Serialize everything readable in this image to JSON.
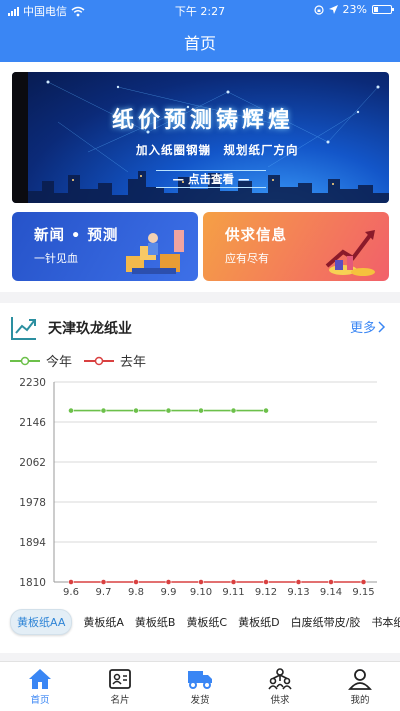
{
  "status_bar": {
    "carrier": "中国电信",
    "time": "下午 2:27",
    "battery": "23%"
  },
  "header": {
    "title": "首页"
  },
  "banner": {
    "title": "纸价预测铸辉煌",
    "subtitle": "加入纸圈钢镚　规划纸厂方向",
    "cta": "— 点击查看 —"
  },
  "cards": [
    {
      "title": "新闻 • 预测",
      "subtitle": "一针见血"
    },
    {
      "title": "供求信息",
      "subtitle": "应有尽有"
    }
  ],
  "company": {
    "name": "天津玖龙纸业",
    "more_label": "更多"
  },
  "colors": {
    "accent": "#3a86f4",
    "this_year": "#6cc04a",
    "last_year": "#d94040"
  },
  "chart_data": {
    "type": "line",
    "x": [
      "9.6",
      "9.7",
      "9.8",
      "9.9",
      "9.10",
      "9.11",
      "9.12",
      "9.13",
      "9.14",
      "9.15"
    ],
    "ylim": [
      1810,
      2230
    ],
    "yticks": [
      "2230",
      "2146",
      "2062",
      "1978",
      "1894",
      "1810"
    ],
    "grid": true,
    "legend_position": "top-left",
    "series": [
      {
        "name": "今年",
        "values": [
          2170,
          2170,
          2170,
          2170,
          2170,
          2170,
          2170
        ]
      },
      {
        "name": "去年",
        "values": [
          1810,
          1810,
          1810,
          1810,
          1810,
          1810,
          1810,
          1810,
          1810,
          1810
        ]
      }
    ]
  },
  "paper_types": [
    "黄板纸AA",
    "黄板纸A",
    "黄板纸B",
    "黄板纸C",
    "黄板纸D",
    "白废纸带皮/胶",
    "书本纸"
  ],
  "tabs": [
    {
      "label": "首页",
      "icon": "home-icon"
    },
    {
      "label": "名片",
      "icon": "business-card-icon"
    },
    {
      "label": "发货",
      "icon": "truck-icon"
    },
    {
      "label": "供求",
      "icon": "people-network-icon"
    },
    {
      "label": "我的",
      "icon": "user-icon"
    }
  ]
}
